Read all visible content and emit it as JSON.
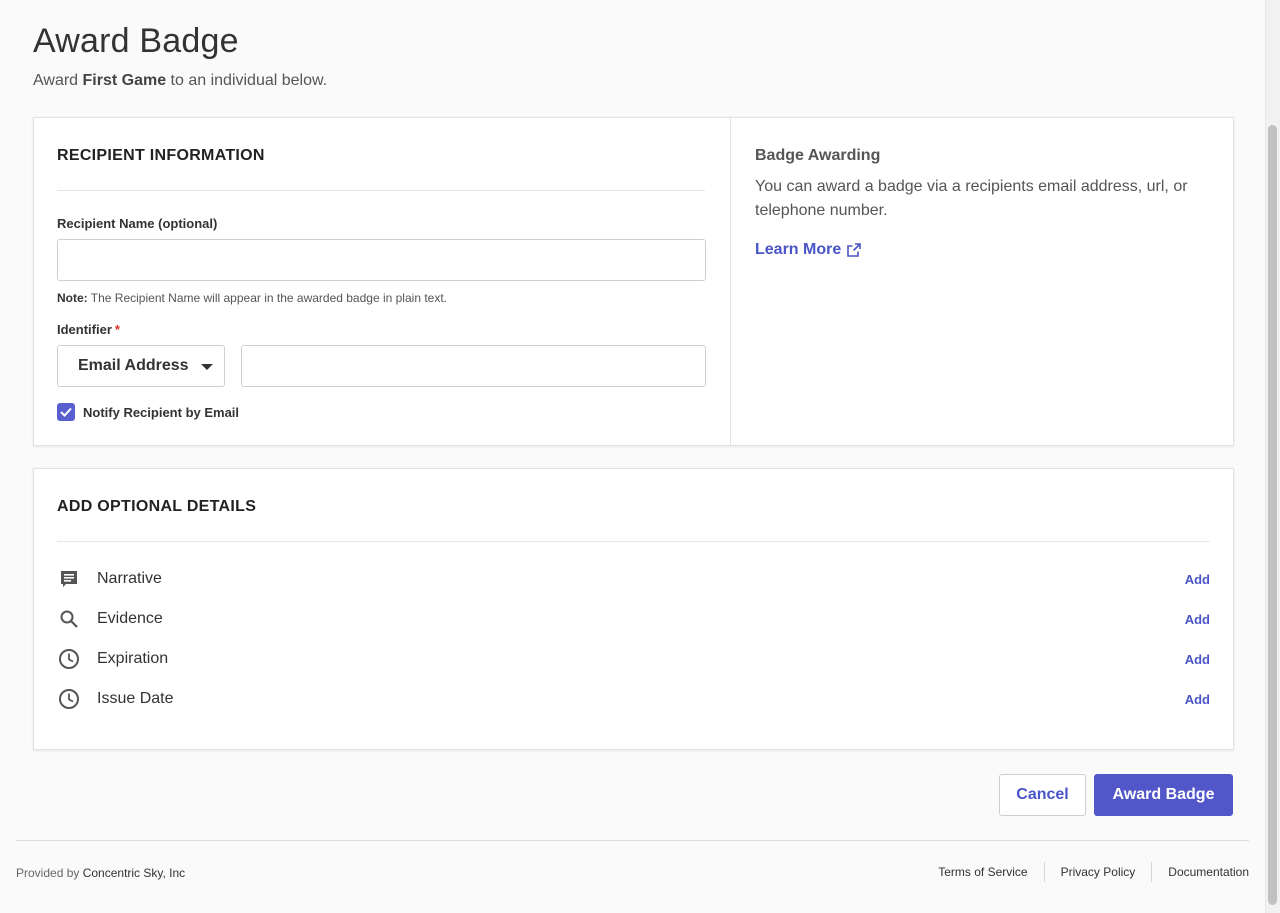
{
  "header": {
    "title": "Award Badge",
    "subtitle_prefix": "Award ",
    "badge_name": "First Game",
    "subtitle_suffix": " to an individual below."
  },
  "recipient": {
    "heading": "RECIPIENT INFORMATION",
    "name_label": "Recipient Name (optional)",
    "name_value": "",
    "note_label": "Note:",
    "note_text": " The Recipient Name will appear in the awarded badge in plain text.",
    "identifier_label": "Identifier",
    "required_mark": "*",
    "identifier_type": "Email Address",
    "identifier_value": "",
    "notify_label": "Notify Recipient by Email",
    "notify_checked": true
  },
  "info": {
    "title": "Badge Awarding",
    "text": "You can award a badge via a recipients email address, url, or telephone number.",
    "learn_more": "Learn More"
  },
  "optional": {
    "heading": "ADD OPTIONAL DETAILS",
    "items": [
      {
        "label": "Narrative",
        "icon": "narrative-icon",
        "action": "Add"
      },
      {
        "label": "Evidence",
        "icon": "search-icon",
        "action": "Add"
      },
      {
        "label": "Expiration",
        "icon": "clock-icon",
        "action": "Add"
      },
      {
        "label": "Issue Date",
        "icon": "clock-icon",
        "action": "Add"
      }
    ]
  },
  "actions": {
    "cancel": "Cancel",
    "award": "Award Badge"
  },
  "footer": {
    "provided_by": "Provided by ",
    "company": "Concentric Sky, Inc",
    "links": [
      "Terms of Service",
      "Privacy Policy",
      "Documentation"
    ]
  },
  "colors": {
    "accent": "#5157c8",
    "link": "#4a55c7",
    "required": "#d9342b"
  }
}
